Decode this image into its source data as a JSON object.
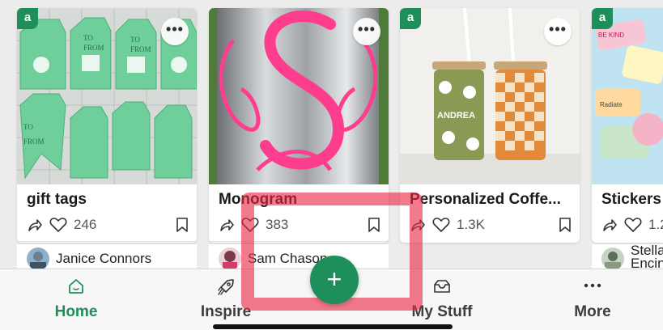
{
  "cards": [
    {
      "title": "gift tags",
      "count": "246",
      "user": "Janice Connors"
    },
    {
      "title": "Monogram",
      "count": "383",
      "user": "Sam Chason"
    },
    {
      "title": "Personalized Coffe...",
      "count": "1.3K",
      "user": ""
    },
    {
      "title": "Stickers",
      "count": "1.2",
      "user": "Stella Encin"
    }
  ],
  "badge_letter": "a",
  "tabs": {
    "home": "Home",
    "inspire": "Inspire",
    "mystuff": "My Stuff",
    "more": "More"
  },
  "fab_label": "+",
  "colors": {
    "brand": "#1e8f5a",
    "highlight": "#ec2846"
  }
}
